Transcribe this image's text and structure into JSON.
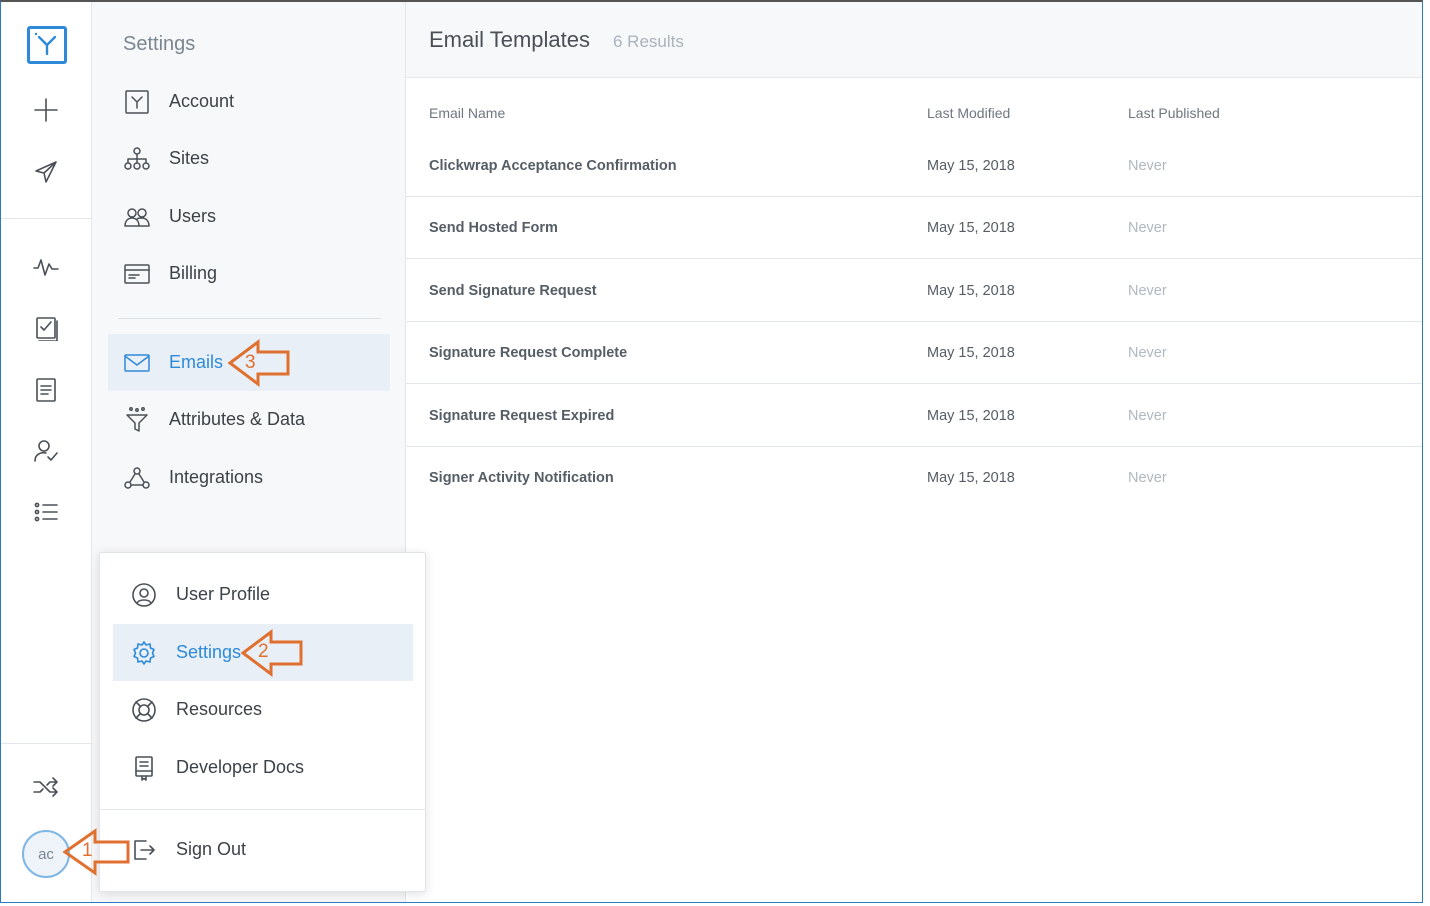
{
  "rail": {
    "avatar_initials": "ac"
  },
  "settings_nav": {
    "title": "Settings",
    "items": [
      {
        "label": "Account",
        "icon": "account-icon"
      },
      {
        "label": "Sites",
        "icon": "sitemap-icon"
      },
      {
        "label": "Users",
        "icon": "users-icon"
      },
      {
        "label": "Billing",
        "icon": "billing-icon"
      },
      {
        "label": "Emails",
        "icon": "envelope-icon",
        "active": true
      },
      {
        "label": "Attributes & Data",
        "icon": "funnel-icon"
      },
      {
        "label": "Integrations",
        "icon": "webhook-icon"
      }
    ]
  },
  "main": {
    "title": "Email Templates",
    "results": "6 Results",
    "columns": {
      "name": "Email Name",
      "modified": "Last Modified",
      "published": "Last Published"
    },
    "rows": [
      {
        "name": "Clickwrap Acceptance Confirmation",
        "modified": "May 15, 2018",
        "published": "Never"
      },
      {
        "name": "Send Hosted Form",
        "modified": "May 15, 2018",
        "published": "Never"
      },
      {
        "name": "Send Signature Request",
        "modified": "May 15, 2018",
        "published": "Never"
      },
      {
        "name": "Signature Request Complete",
        "modified": "May 15, 2018",
        "published": "Never"
      },
      {
        "name": "Signature Request Expired",
        "modified": "May 15, 2018",
        "published": "Never"
      },
      {
        "name": "Signer Activity Notification",
        "modified": "May 15, 2018",
        "published": "Never"
      }
    ]
  },
  "user_menu": {
    "items": [
      {
        "label": "User Profile",
        "icon": "user-circle-icon"
      },
      {
        "label": "Settings",
        "icon": "gear-icon",
        "active": true
      },
      {
        "label": "Resources",
        "icon": "lifebuoy-icon"
      },
      {
        "label": "Developer Docs",
        "icon": "docs-icon"
      }
    ],
    "sign_out": "Sign Out"
  },
  "annotations": [
    "1",
    "2",
    "3"
  ],
  "colors": {
    "accent": "#2e8ad8",
    "annotation": "#e07030"
  }
}
